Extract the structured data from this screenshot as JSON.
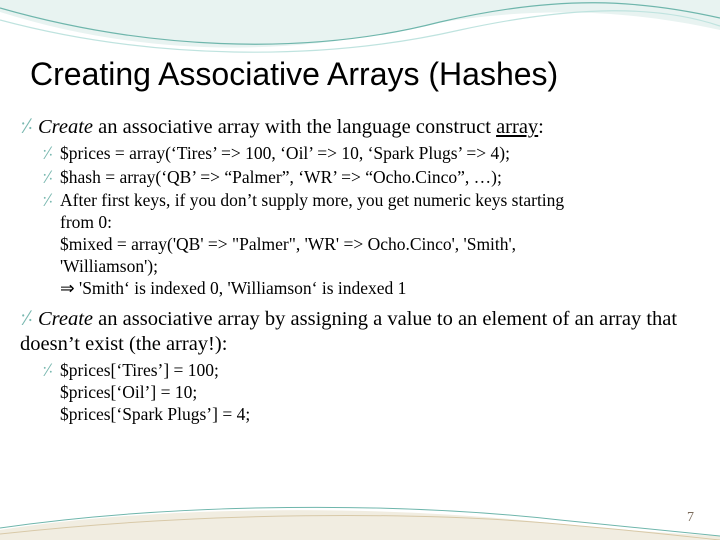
{
  "title": "Creating Associative Arrays (Hashes)",
  "bullet_glyph": "⸓",
  "arrow_glyph": "⇒",
  "p1": {
    "lead": "Create",
    "rest": " an associative array with the language construct ",
    "tail": "array",
    "colon": ":"
  },
  "p1s1": "$prices = array(‘Tires’ => 100, ‘Oil’ => 10, ‘Spark Plugs’ => 4);",
  "p1s2": "$hash = array(‘QB’ => “Palmer”, ‘WR’ => “Ocho.Cinco”, …);",
  "p1s3a": "After first keys, if you don’t supply more, you get numeric keys starting",
  "p1s3b": "from 0:",
  "p1s3c": "$mixed = array('QB' => \"Palmer\", 'WR' => Ocho.Cinco', 'Smith',",
  "p1s3d": "'Williamson');",
  "p1s3e": " 'Smith‘ is indexed 0, 'Williamson‘ is indexed 1",
  "p2": {
    "lead": "Create",
    "rest": " an associative array by assigning a value to an element of an array that doesn’t exist (the array!):"
  },
  "p2s1": "$prices[‘Tires’] = 100;",
  "p2s2": "$prices[‘Oil’] = 10;",
  "p2s3": "$prices[‘Spark Plugs’] = 4;",
  "pagenum": "7",
  "colors": {
    "tealLight": "#bfe3df",
    "tealMid": "#6fb6ac",
    "sand": "#d8c9a8"
  }
}
